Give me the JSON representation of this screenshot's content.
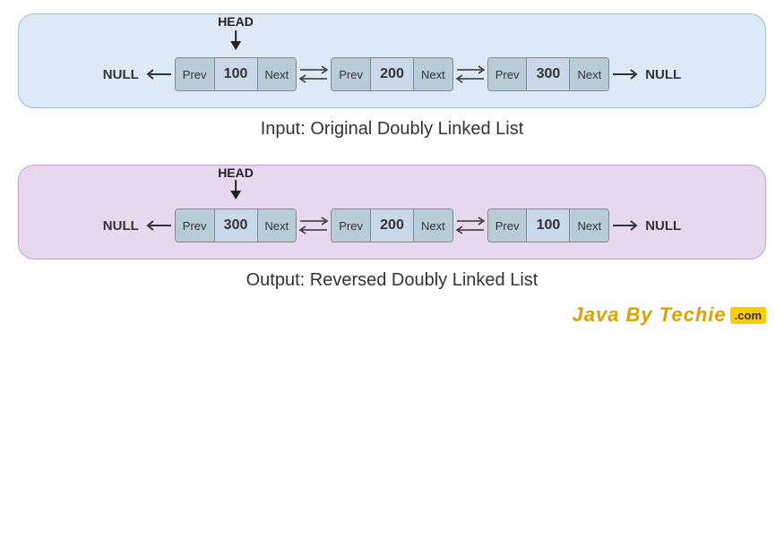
{
  "original": {
    "title": "Input: Original Doubly Linked List",
    "head_label": "HEAD",
    "nodes": [
      {
        "prev": "Prev",
        "value": "100",
        "next": "Next"
      },
      {
        "prev": "Prev",
        "value": "200",
        "next": "Next"
      },
      {
        "prev": "Prev",
        "value": "300",
        "next": "Next"
      }
    ],
    "null_left": "NULL",
    "null_right": "NULL"
  },
  "reversed": {
    "title": "Output: Reversed Doubly Linked List",
    "head_label": "HEAD",
    "nodes": [
      {
        "prev": "Prev",
        "value": "300",
        "next": "Next"
      },
      {
        "prev": "Prev",
        "value": "200",
        "next": "Next"
      },
      {
        "prev": "Prev",
        "value": "100",
        "next": "Next"
      }
    ],
    "null_left": "NULL",
    "null_right": "NULL"
  },
  "watermark": {
    "text": "Java By Techie",
    "com": ".com"
  }
}
